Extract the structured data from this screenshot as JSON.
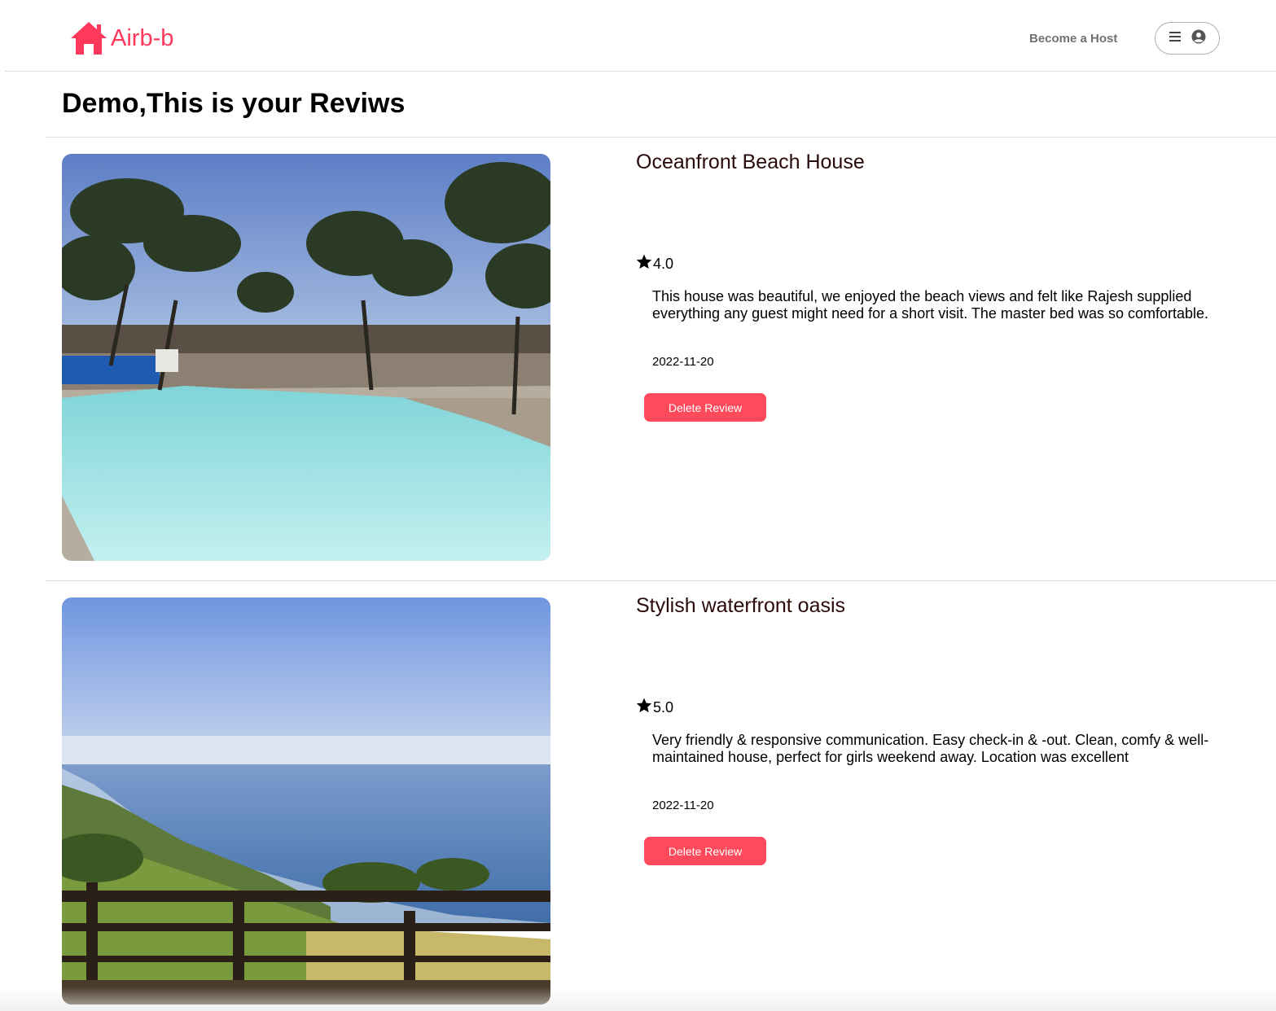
{
  "header": {
    "logo_text": "Airb-b",
    "logo_icon": "house-icon",
    "become_host_label": "Become a Host",
    "menu_icon": "hamburger-icon",
    "profile_icon": "user-circle-icon",
    "brand_color": "#ff385c"
  },
  "page": {
    "title": "Demo,This is your Reviws"
  },
  "reviews": [
    {
      "listing_name": "Oceanfront Beach House",
      "rating_icon": "star-icon",
      "rating": "4.0",
      "review_text": "This house was beautiful, we enjoyed the beach views and felt like Rajesh supplied everything any guest might need for a short visit. The master bed was so comfortable.",
      "date": "2022-11-20",
      "delete_label": "Delete Review"
    },
    {
      "listing_name": "Stylish waterfront oasis",
      "rating_icon": "star-icon",
      "rating": "5.0",
      "review_text": "Very friendly & responsive communication. Easy check-in & -out. Clean, comfy & well-maintained house, perfect for girls weekend away. Location was excellent",
      "date": "2022-11-20",
      "delete_label": "Delete Review"
    }
  ],
  "colors": {
    "delete_button": "#ff4a5c",
    "listing_name": "#2a0a0a",
    "divider": "#dddddd"
  }
}
